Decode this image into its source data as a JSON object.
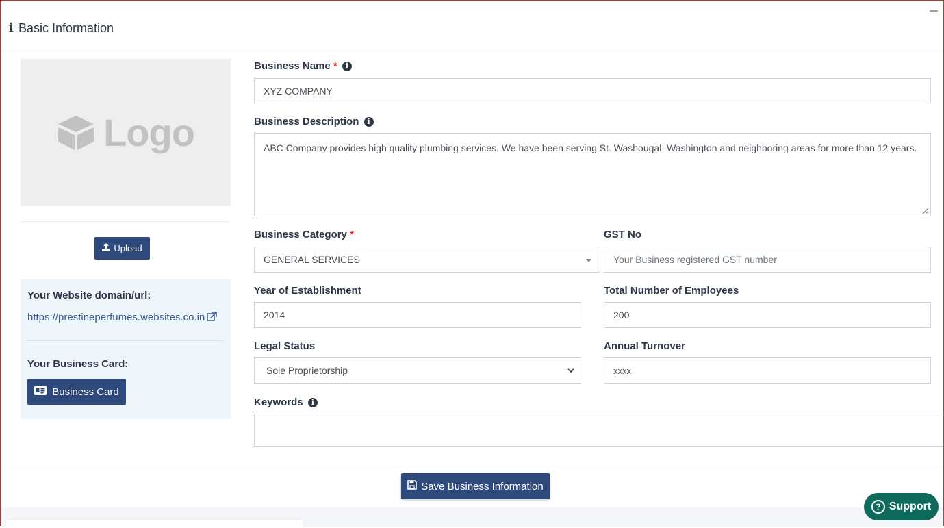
{
  "header": {
    "title": "Basic Information",
    "icon": "info-icon"
  },
  "left": {
    "logo_text": "Logo",
    "upload_label": "Upload",
    "website_label": "Your Website domain/url:",
    "website_url": "https://prestineperfumes.websites.co.in",
    "business_card_label": "Your Business Card:",
    "business_card_button": "Business Card"
  },
  "form": {
    "business_name": {
      "label": "Business Name",
      "required": "*",
      "value": "XYZ COMPANY"
    },
    "business_description": {
      "label": "Business Description",
      "value": "ABC Company provides high quality plumbing services. We have been serving St. Washougal, Washington and neighboring areas for more than 12 years."
    },
    "business_category": {
      "label": "Business Category",
      "required": "*",
      "value": "GENERAL SERVICES"
    },
    "gst_no": {
      "label": "GST No",
      "placeholder": "Your Business registered  GST number"
    },
    "year_of_establishment": {
      "label": "Year of Establishment",
      "value": "2014"
    },
    "total_employees": {
      "label": "Total Number of Employees",
      "value": "200"
    },
    "legal_status": {
      "label": "Legal Status",
      "value": "Sole Proprietorship"
    },
    "annual_turnover": {
      "label": "Annual Turnover",
      "value": "xxxx"
    },
    "keywords": {
      "label": "Keywords",
      "value": ""
    }
  },
  "actions": {
    "save_label": "Save Business Information",
    "support_label": "Support"
  },
  "colors": {
    "primary": "#2e4a7d",
    "support": "#0e6b5c",
    "panel": "#eef5fb",
    "required": "#e3342f"
  }
}
